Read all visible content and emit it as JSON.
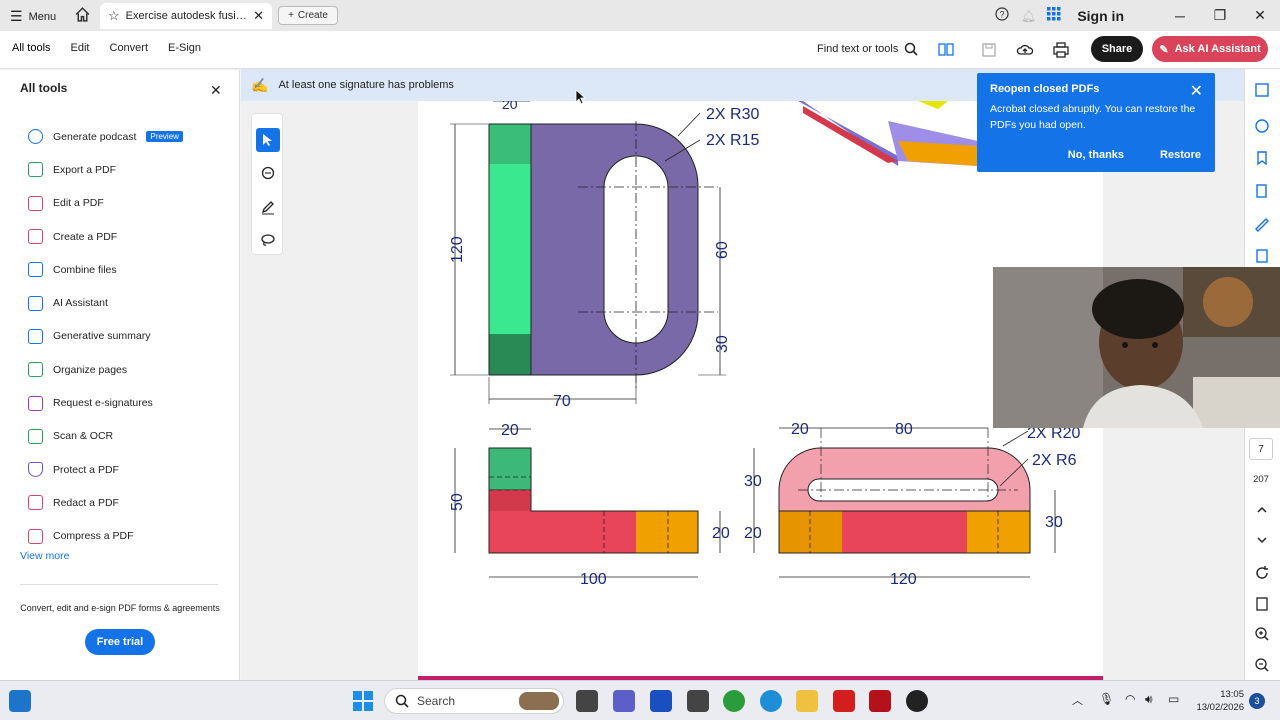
{
  "titlebar": {
    "menu_label": "Menu",
    "tab_title": "Exercise autodesk fusion...",
    "create_label": "Create",
    "signin_label": "Sign in"
  },
  "toolbar": {
    "menu_items": [
      "All tools",
      "Edit",
      "Convert",
      "E-Sign"
    ],
    "find_label": "Find text or tools",
    "share_label": "Share",
    "ai_label": "Ask AI Assistant"
  },
  "sidebar": {
    "title": "All tools",
    "items": [
      {
        "label": "Generate podcast",
        "badge": "Preview",
        "icon": "podcast-icon",
        "color": "#1473e6"
      },
      {
        "label": "Export a PDF",
        "icon": "export-pdf-icon",
        "color": "#2d9d5b"
      },
      {
        "label": "Edit a PDF",
        "icon": "edit-pdf-icon",
        "color": "#d4456a"
      },
      {
        "label": "Create a PDF",
        "icon": "create-pdf-icon",
        "color": "#d4456a"
      },
      {
        "label": "Combine files",
        "icon": "combine-files-icon",
        "color": "#1473e6"
      },
      {
        "label": "AI Assistant",
        "icon": "ai-assistant-icon",
        "color": "#1473e6"
      },
      {
        "label": "Generative summary",
        "icon": "summary-icon",
        "color": "#1473e6"
      },
      {
        "label": "Organize pages",
        "icon": "organize-pages-icon",
        "color": "#2d9d5b"
      },
      {
        "label": "Request e-signatures",
        "icon": "signature-icon",
        "color": "#9b3fb4"
      },
      {
        "label": "Scan & OCR",
        "icon": "scan-icon",
        "color": "#2d9d5b"
      },
      {
        "label": "Protect a PDF",
        "icon": "protect-icon",
        "color": "#6c4fd6"
      },
      {
        "label": "Redact a PDF",
        "icon": "redact-icon",
        "color": "#d4456a"
      },
      {
        "label": "Compress a PDF",
        "icon": "compress-icon",
        "color": "#d4456a"
      }
    ],
    "view_more": "View more",
    "promo_text": "Convert, edit and e-sign PDF forms & agreements",
    "trial_label": "Free trial"
  },
  "signature_bar": {
    "message": "At least one signature has problems"
  },
  "popup": {
    "title": "Reopen closed PDFs",
    "body": "Acrobat closed abruptly. You can restore the PDFs you had open.",
    "no_label": "No, thanks",
    "restore_label": "Restore"
  },
  "drawing": {
    "dims": {
      "top_20": "20",
      "r30": "2X R30",
      "r15": "2X R15",
      "h120": "120",
      "h60": "60",
      "h30": "30",
      "w70": "70",
      "side_20": "20",
      "side_50": "50",
      "side_20b": "20",
      "side_100": "100",
      "r_20": "20",
      "r_80": "80",
      "r_R20": "2X R20",
      "r_R6": "2X R6",
      "r_30": "30",
      "r_20b": "20",
      "r_30b": "30",
      "r_120": "120"
    }
  },
  "page_nav": {
    "current": "7",
    "total": "207"
  },
  "taskbar": {
    "search_label": "Search",
    "time": "13:05",
    "date": "13/02/2026",
    "notifications": "3"
  }
}
